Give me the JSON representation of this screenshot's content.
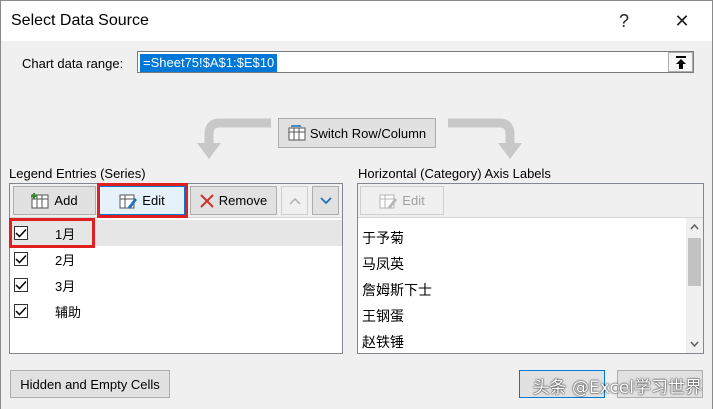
{
  "window": {
    "title": "Select Data Source",
    "help_glyph": "?",
    "close_glyph": "✕"
  },
  "range": {
    "label": "Chart data range:",
    "value": "=Sheet75!$A$1:$E$10"
  },
  "switch_button": {
    "label": "Switch Row/Column"
  },
  "legend": {
    "label": "Legend Entries (Series)",
    "add_label": "Add",
    "edit_label": "Edit",
    "remove_label": "Remove",
    "items": [
      {
        "name": "1月",
        "checked": true
      },
      {
        "name": "2月",
        "checked": true
      },
      {
        "name": "3月",
        "checked": true
      },
      {
        "name": "辅助",
        "checked": true
      }
    ]
  },
  "axis": {
    "label": "Horizontal (Category) Axis Labels",
    "edit_label": "Edit",
    "items": [
      "于予菊",
      "马凤英",
      "詹姆斯下士",
      "王钢蛋",
      "赵铁锤"
    ]
  },
  "footer": {
    "hidden_cells_label": "Hidden and Empty Cells",
    "watermark": "头条 @Excel学习世界"
  },
  "colors": {
    "highlight_red": "#e02020",
    "selection_blue": "#0078d7"
  }
}
